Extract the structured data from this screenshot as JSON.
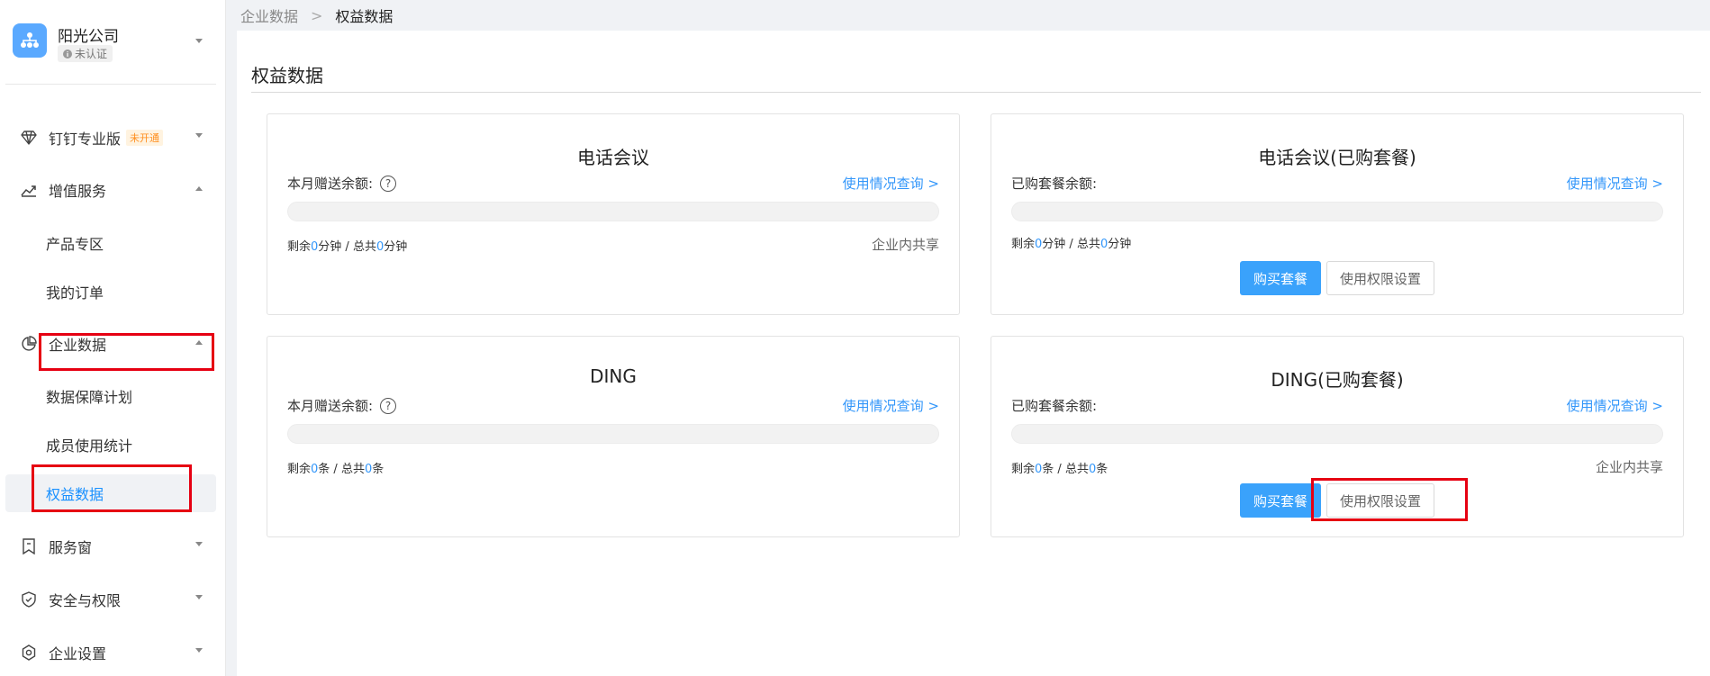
{
  "org": {
    "name": "阳光公司",
    "badge": "未认证"
  },
  "menu": {
    "pro": {
      "label": "钉钉专业版",
      "tag": "未开通"
    },
    "value_added": {
      "label": "增值服务"
    },
    "products": {
      "label": "产品专区"
    },
    "orders": {
      "label": "我的订单"
    },
    "enterprise_data": {
      "label": "企业数据"
    },
    "data_plan": {
      "label": "数据保障计划"
    },
    "member_stats": {
      "label": "成员使用统计"
    },
    "rights_data": {
      "label": "权益数据"
    },
    "service_window": {
      "label": "服务窗"
    },
    "security": {
      "label": "安全与权限"
    },
    "settings": {
      "label": "企业设置"
    }
  },
  "breadcrumb": {
    "parent": "企业数据",
    "current": "权益数据",
    "separator": ">"
  },
  "page_title": "权益数据",
  "cards": {
    "phone": {
      "title": "电话会议",
      "label": "本月赠送余额:",
      "link": "使用情况查询 >",
      "remain_prefix": "剩余",
      "remain_value": "0",
      "remain_unit": "分钟 / 总共",
      "total_value": "0",
      "total_unit": "分钟",
      "share": "企业内共享"
    },
    "phone_bought": {
      "title": "电话会议(已购套餐)",
      "label": "已购套餐余额:",
      "link": "使用情况查询 >",
      "remain_prefix": "剩余",
      "remain_value": "0",
      "remain_unit": "分钟 / 总共",
      "total_value": "0",
      "total_unit": "分钟",
      "buy": "购买套餐",
      "perm": "使用权限设置"
    },
    "ding": {
      "title": "DING",
      "label": "本月赠送余额:",
      "link": "使用情况查询 >",
      "remain_prefix": "剩余",
      "remain_value": "0",
      "remain_unit": "条 / 总共",
      "total_value": "0",
      "total_unit": "条"
    },
    "ding_bought": {
      "title": "DING(已购套餐)",
      "label": "已购套餐余额:",
      "link": "使用情况查询 >",
      "remain_prefix": "剩余",
      "remain_value": "0",
      "remain_unit": "条 / 总共",
      "total_value": "0",
      "total_unit": "条",
      "share": "企业内共享",
      "buy": "购买套餐",
      "perm": "使用权限设置"
    }
  },
  "colors": {
    "accent": "#3296fa",
    "primary_button": "#3aa2fb",
    "highlight_box": "#e60012",
    "tag": "#ff8f1f"
  }
}
